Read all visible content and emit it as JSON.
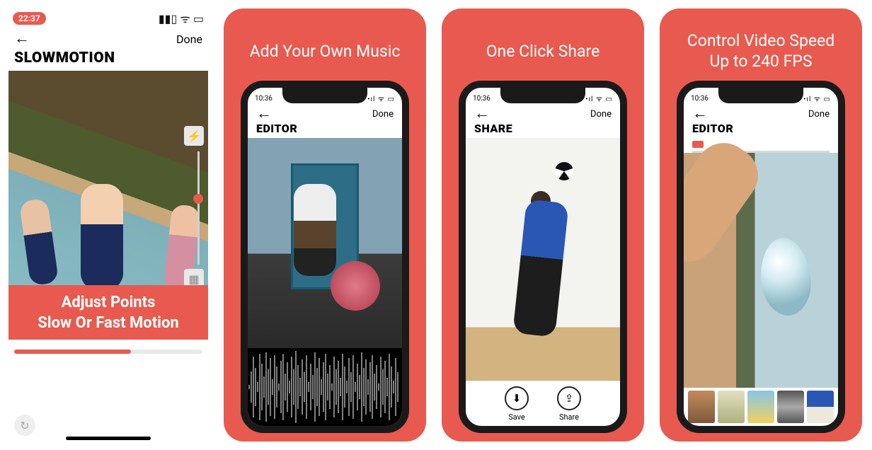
{
  "accent": "#e85a4f",
  "panel1": {
    "status_time": "22:37",
    "done": "Done",
    "title": "SLOWMOTION",
    "overlay_line1": "Adjust Points",
    "overlay_line2": "Slow Or Fast Motion",
    "progress_pct": 62
  },
  "panel2": {
    "headline": "Add Your Own Music",
    "status_time": "10:36",
    "done": "Done",
    "title": "EDITOR"
  },
  "panel3": {
    "headline": "One Click Share",
    "status_time": "10:36",
    "done": "Done",
    "title": "SHARE",
    "save_label": "Save",
    "share_label": "Share"
  },
  "panel4": {
    "headline_line1": "Control Video Speed",
    "headline_line2": "Up to 240 FPS",
    "status_time": "10:36",
    "done": "Done",
    "title": "EDITOR"
  }
}
